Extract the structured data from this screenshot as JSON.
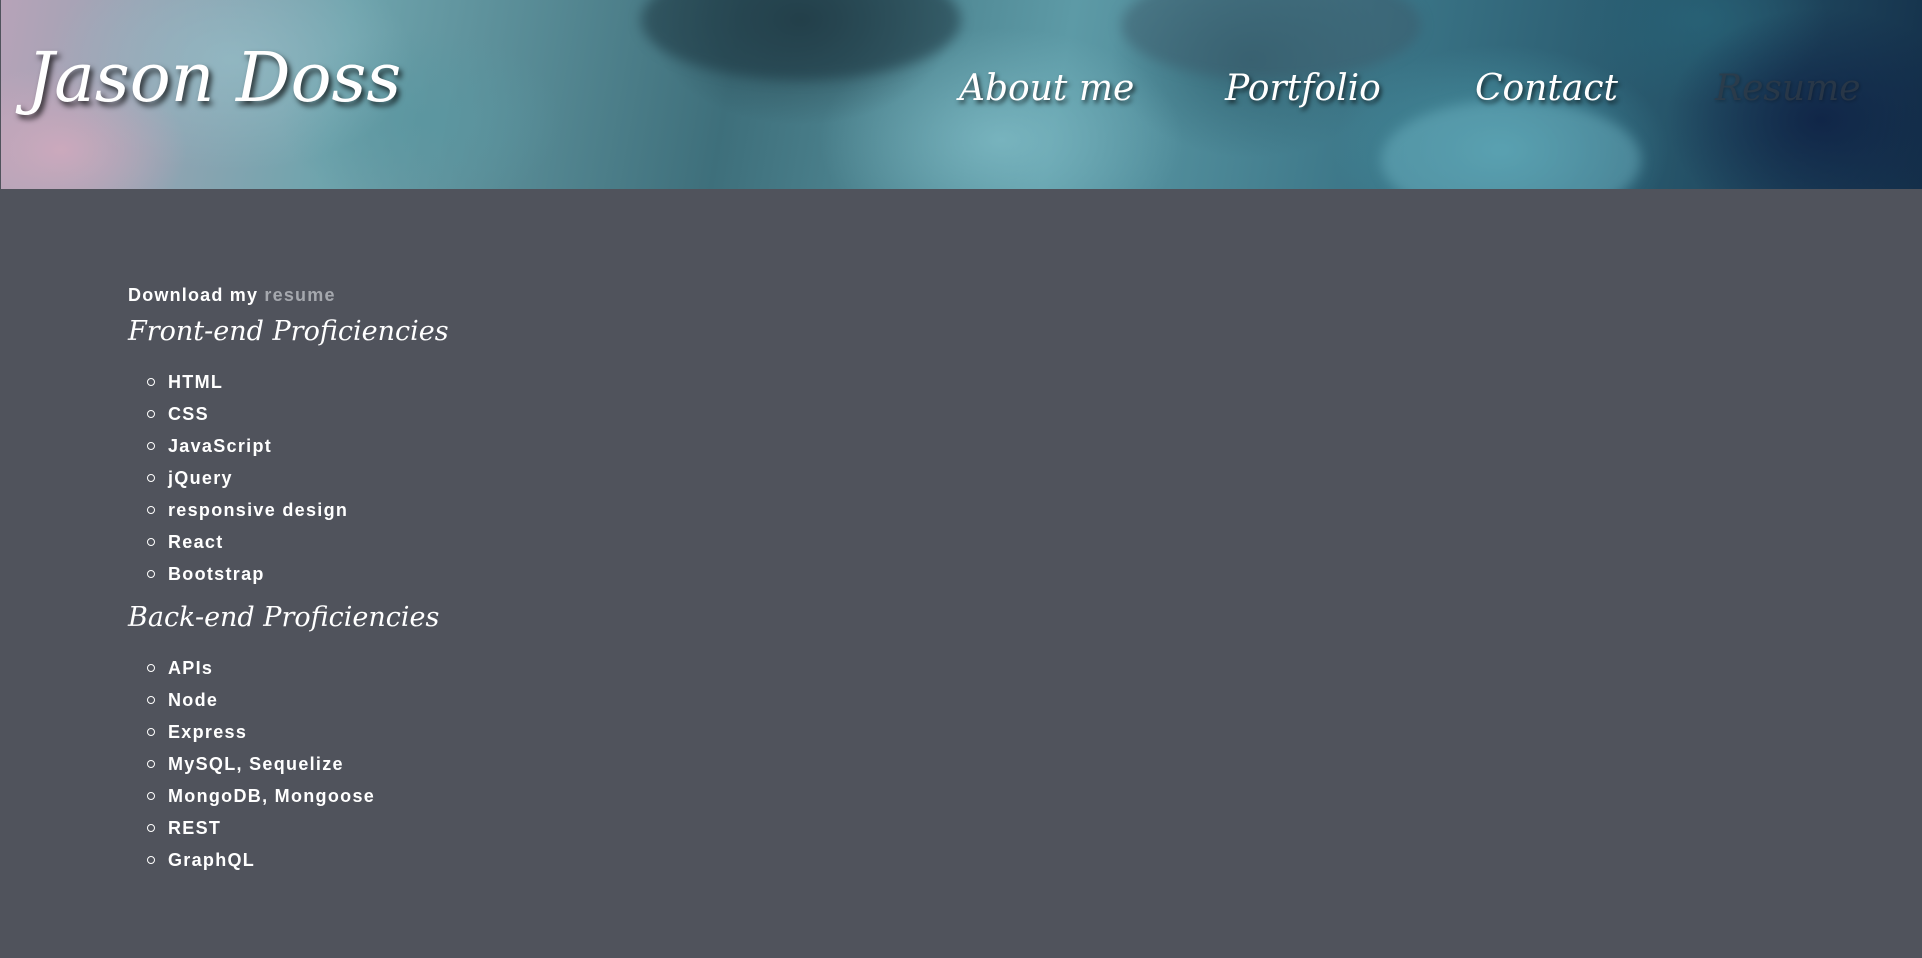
{
  "header": {
    "site_title": "Jason Doss",
    "nav": [
      {
        "label": "About me",
        "active": false
      },
      {
        "label": "Portfolio",
        "active": false
      },
      {
        "label": "Contact",
        "active": false
      },
      {
        "label": "Resume",
        "active": true
      }
    ]
  },
  "main": {
    "download_prefix": "Download my",
    "download_link": "resume",
    "frontend": {
      "heading": "Front-end Proficiencies",
      "items": [
        "HTML",
        "CSS",
        "JavaScript",
        "jQuery",
        "responsive design",
        "React",
        "Bootstrap"
      ]
    },
    "backend": {
      "heading": "Back-end Proficiencies",
      "items": [
        "APIs",
        "Node",
        "Express",
        "MySQL, Sequelize",
        "MongoDB, Mongoose",
        "REST",
        "GraphQL"
      ]
    }
  },
  "colors": {
    "page_background": "#50535c",
    "text": "#ffffff",
    "link_muted": "#a5a8ae",
    "active_nav": "#2f3a46"
  }
}
